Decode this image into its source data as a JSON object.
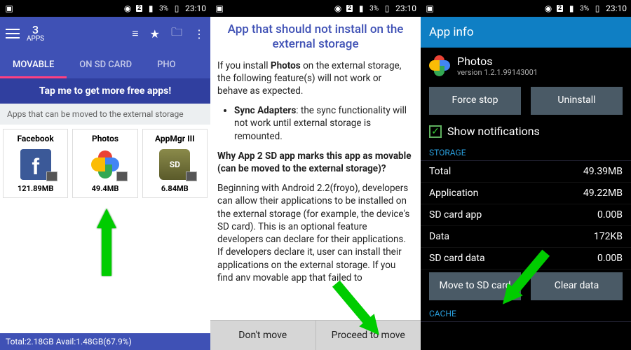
{
  "status": {
    "sim": "2",
    "battery": "3%",
    "time": "23:10"
  },
  "p1": {
    "apps_count": "3",
    "apps_label": "APPS",
    "tabs": [
      "MOVABLE",
      "ON SD CARD",
      "PHO"
    ],
    "banner": "Tap me to get more free apps!",
    "subhead": "Apps that can be moved to the external storage",
    "cards": [
      {
        "name": "Facebook",
        "size": "121.89MB"
      },
      {
        "name": "Photos",
        "size": "49.4MB"
      },
      {
        "name": "AppMgr III",
        "size": "6.84MB"
      }
    ],
    "footer": "Total:2.18GB   Avail:1.48GB(67.9%)"
  },
  "p2": {
    "title": "App that should not install on the external storage",
    "intro_a": "If you install ",
    "intro_b": "Photos",
    "intro_c": " on the external storage, the following feature(s) will not work or behave as expected.",
    "bullet_a": "Sync Adapters",
    "bullet_b": ": the sync functionality will not work until external storage is remounted.",
    "question": "Why App 2 SD app marks this app as movable (can be moved to the external storage)?",
    "body": "Beginning with Android 2.2(froyo), developers can allow their applications to be installed on the external storage (for example, the device's SD card). This is an optional feature developers can declare for their applications. If developers declare it, user can install their applications on the external storage. If you find anv movable app that failed to",
    "btn_no": "Don't move",
    "btn_yes": "Proceed to move"
  },
  "p3": {
    "title": "App info",
    "app_name": "Photos",
    "app_ver": "version 1.2.1.99143001",
    "btn_force": "Force stop",
    "btn_uninstall": "Uninstall",
    "show_notif": "Show notifications",
    "sec_storage": "STORAGE",
    "sec_cache": "CACHE",
    "rows": [
      {
        "k": "Total",
        "v": "49.39MB"
      },
      {
        "k": "Application",
        "v": "49.22MB"
      },
      {
        "k": "SD card app",
        "v": "0.00B"
      },
      {
        "k": "Data",
        "v": "172KB"
      },
      {
        "k": "SD card data",
        "v": "0.00B"
      }
    ],
    "btn_move": "Move to SD card",
    "btn_clear": "Clear data"
  }
}
